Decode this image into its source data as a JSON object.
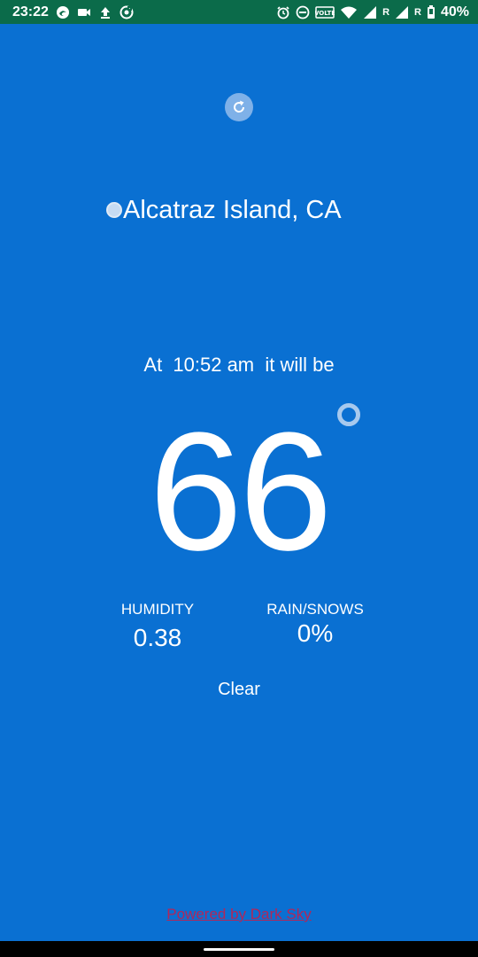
{
  "status_bar": {
    "time": "23:22",
    "network_label_1": "R",
    "network_label_2": "R",
    "battery": "40%",
    "volte_label": "VOLTE",
    "icons": [
      "edge-icon",
      "video-icon",
      "upload-icon",
      "sync-icon",
      "alarm-icon",
      "dnd-icon",
      "volte-icon",
      "wifi-icon",
      "signal-icon",
      "signal-icon",
      "battery-icon"
    ]
  },
  "weather": {
    "location": "Alcatraz Island, CA",
    "forecast_line": "At  10:52 am  it will be",
    "temperature": "66",
    "humidity_label": "HUMIDITY",
    "humidity_value": "0.38",
    "rain_label": "RAIN/SNOWS",
    "rain_value": "0%",
    "summary": "Clear"
  },
  "footer": {
    "powered_by": "Powered by Dark Sky"
  },
  "colors": {
    "background": "#0a70d2",
    "status_bar": "#0b6b4a",
    "link": "#b0275a"
  }
}
